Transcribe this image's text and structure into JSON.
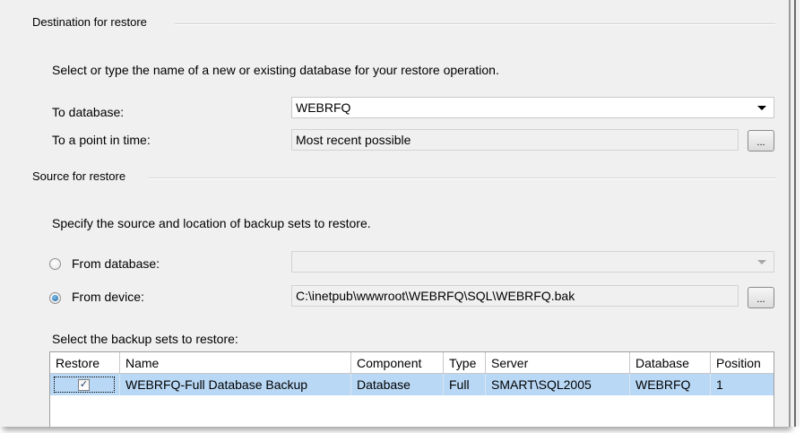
{
  "destination": {
    "group_title": "Destination for restore",
    "description": "Select or type the name of a new or existing database for your restore operation.",
    "to_database_label": "To database:",
    "to_database_value": "WEBRFQ",
    "point_in_time_label": "To a point in time:",
    "point_in_time_value": "Most recent possible",
    "browse_label": "..."
  },
  "source": {
    "group_title": "Source for restore",
    "description": "Specify the source and location of backup sets to restore.",
    "from_database_label": "From database:",
    "from_database_value": "",
    "from_device_label": "From device:",
    "from_device_value": "C:\\inetpub\\wwwroot\\WEBRFQ\\SQL\\WEBRFQ.bak",
    "selected_option": "From device",
    "browse_label": "..."
  },
  "backup_sets": {
    "label": "Select the backup sets to restore:",
    "columns": [
      "Restore",
      "Name",
      "Component",
      "Type",
      "Server",
      "Database",
      "Position"
    ],
    "rows": [
      {
        "restore": true,
        "name": "WEBRFQ-Full Database Backup",
        "component": "Database",
        "type": "Full",
        "server": "SMART\\SQL2005",
        "database": "WEBRFQ",
        "position": "1"
      }
    ]
  },
  "icons": {
    "dropdown": "chevron-down-icon",
    "radio": "radio-icon",
    "checkbox": "checkbox-icon"
  },
  "colors": {
    "panel_bg": "#f0f0f0",
    "selected_row": "#b9d8f5",
    "radio_dot": "#1f5e95"
  }
}
